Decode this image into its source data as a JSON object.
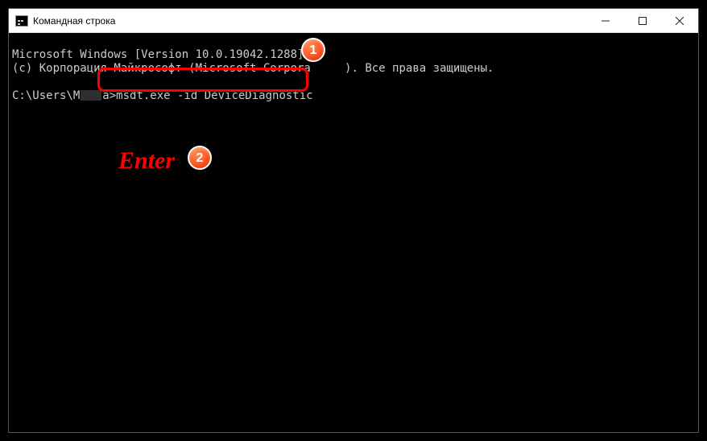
{
  "window": {
    "title": "Командная строка"
  },
  "console": {
    "line1": "Microsoft Windows [Version 10.0.19042.1288]",
    "line2_a": "(c) Корпорация Майкрософт (Microsoft Corpora",
    "line2_b": "). Все права защищены.",
    "prompt_prefix": "C:\\Users\\М",
    "prompt_suffix": "а>",
    "command": "msdt.exe -id DeviceDiagnostic"
  },
  "annotations": {
    "badge1": "1",
    "badge2": "2",
    "enter_label": "Enter"
  }
}
